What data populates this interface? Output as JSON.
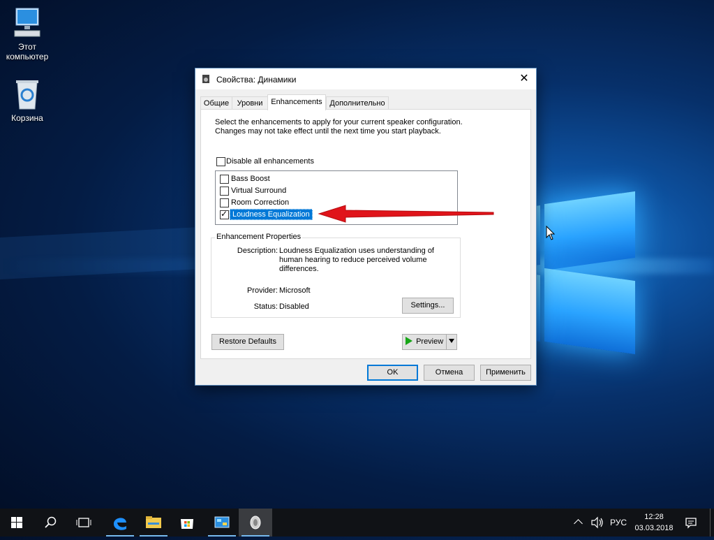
{
  "desktop": {
    "icons": [
      {
        "label_line1": "Этот",
        "label_line2": "компьютер",
        "icon": "computer-icon"
      },
      {
        "label_line1": "Корзина",
        "icon": "recycle-bin-icon"
      }
    ]
  },
  "dialog": {
    "title": "Свойства: Динамики",
    "close_label": "✕",
    "tabs": [
      {
        "label": "Общие"
      },
      {
        "label": "Уровни"
      },
      {
        "label": "Enhancements",
        "active": true
      },
      {
        "label": "Дополнительно"
      }
    ],
    "intro_text": "Select the enhancements to apply for your current speaker configuration. Changes may not take effect until the next time you start playback.",
    "disable_all_label": "Disable all enhancements",
    "disable_all_checked": false,
    "enhancements": [
      {
        "label": "Bass Boost",
        "checked": false
      },
      {
        "label": "Virtual Surround",
        "checked": false
      },
      {
        "label": "Room Correction",
        "checked": false
      },
      {
        "label": "Loudness Equalization",
        "checked": true,
        "selected": true
      }
    ],
    "properties": {
      "group_title": "Enhancement Properties",
      "description_label": "Description:",
      "description_value": "Loudness Equalization uses understanding of human hearing to reduce perceived volume differences.",
      "provider_label": "Provider:",
      "provider_value": "Microsoft",
      "status_label": "Status:",
      "status_value": "Disabled",
      "settings_button": "Settings..."
    },
    "restore_defaults_button": "Restore Defaults",
    "preview_button": "Preview",
    "ok_button": "OK",
    "cancel_button": "Отмена",
    "apply_button": "Применить"
  },
  "annotation": {
    "arrow_color": "#e0141a",
    "icon": "red-arrow-icon"
  },
  "taskbar": {
    "items": [
      "start-icon",
      "search-icon",
      "task-view-icon",
      "edge-icon",
      "file-explorer-icon",
      "store-icon",
      "control-panel-icon",
      "speaker-app-icon"
    ],
    "tray": {
      "language": "РУС",
      "time": "12:28",
      "date": "03.03.2018"
    }
  }
}
